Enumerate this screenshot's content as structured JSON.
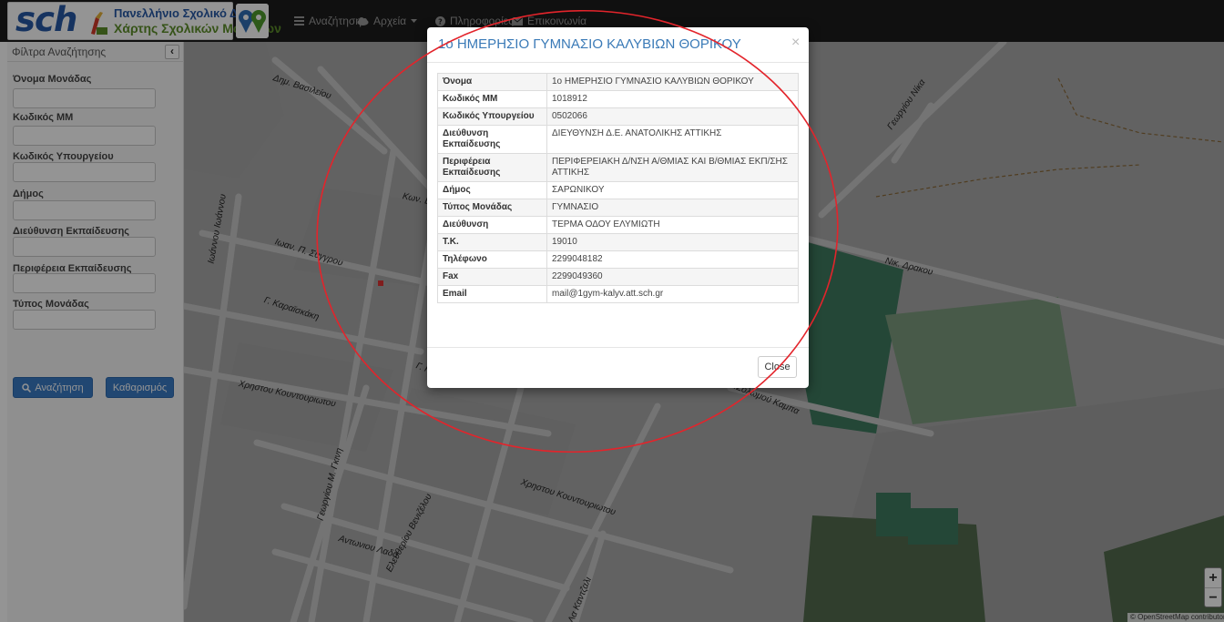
{
  "brand": {
    "logo_text": "sch",
    "line1": "Πανελλήνιο Σχολικό Δίκτυο",
    "line2": "Χάρτης Σχολικών Μονάδων"
  },
  "nav": {
    "search": "Αναζήτηση",
    "files": "Αρχεία",
    "info": "Πληροφορίες",
    "contact": "Επικοινωνία"
  },
  "sidebar": {
    "title": "Φίλτρα Αναζήτησης",
    "collapse_glyph": "‹",
    "filters": [
      {
        "label": "Όνομα Μονάδας",
        "value": ""
      },
      {
        "label": "Κωδικός ΜΜ",
        "value": ""
      },
      {
        "label": "Κωδικός Υπουργείου",
        "value": ""
      },
      {
        "label": "Δήμος",
        "value": ""
      },
      {
        "label": "Διεύθυνση Εκπαίδευσης",
        "value": ""
      },
      {
        "label": "Περιφέρεια Εκπαίδευσης",
        "value": ""
      },
      {
        "label": "Τύπος Μονάδας",
        "value": ""
      }
    ],
    "search_button": "Αναζήτηση",
    "clear_button": "Καθαρισμός"
  },
  "map": {
    "streets": [
      "Δημ. Βασιλείου",
      "Ιωάννου Ιωάννου",
      "Κων. Ελ...",
      "Ιωαν. Π. Συγγρου",
      "Γ. Καραϊσκάκη",
      "Χρηστου Κουντουριωτου",
      "Γεωργίου Μ. Γκινη",
      "Αντωνιου Λαδα",
      "Ελευθερίου Βενιζέλου",
      "Χρηστου Κουντουριωτου",
      "Γεωργίου Νίκα",
      "Νικ. Δρακου",
      "Δ.Σολωμού Καμπα",
      "Γ. Κ...",
      "Λα Καντζαλι"
    ],
    "zoom_in": "+",
    "zoom_out": "−",
    "attribution": "© OpenStreetMap contributors"
  },
  "modal": {
    "title": "1ο ΗΜΕΡΗΣΙΟ ΓΥΜΝΑΣΙΟ ΚΑΛΥΒΙΩΝ ΘΟΡΙΚΟΥ",
    "close_glyph": "×",
    "rows": [
      {
        "key": "Όνομα",
        "value": "1ο ΗΜΕΡΗΣΙΟ ΓΥΜΝΑΣΙΟ ΚΑΛΥΒΙΩΝ ΘΟΡΙΚΟΥ"
      },
      {
        "key": "Κωδικός ΜΜ",
        "value": "1018912"
      },
      {
        "key": "Κωδικός Υπουργείου",
        "value": "0502066"
      },
      {
        "key": "Διεύθυνση Εκπαίδευσης",
        "value": "ΔΙΕΥΘΥΝΣΗ Δ.Ε. ΑΝΑΤΟΛΙΚΗΣ ΑΤΤΙΚΗΣ"
      },
      {
        "key": "Περιφέρεια Εκπαίδευσης",
        "value": "ΠΕΡΙΦΕΡΕΙΑΚΗ Δ/ΝΣΗ Α/ΘΜΙΑΣ ΚΑΙ Β/ΘΜΙΑΣ ΕΚΠ/ΣΗΣ ΑΤΤΙΚΗΣ"
      },
      {
        "key": "Δήμος",
        "value": "ΣΑΡΩΝΙΚΟΥ"
      },
      {
        "key": "Τύπος Μονάδας",
        "value": "ΓΥΜΝΑΣΙΟ"
      },
      {
        "key": "Διεύθυνση",
        "value": "ΤΕΡΜΑ ΟΔΟΥ ΕΛΥΜΙΩΤΗ"
      },
      {
        "key": "Τ.Κ.",
        "value": "19010"
      },
      {
        "key": "Τηλέφωνο",
        "value": "2299048182"
      },
      {
        "key": "Fax",
        "value": "2299049360"
      },
      {
        "key": "Email",
        "value": "mail@1gym-kalyv.att.sch.gr"
      }
    ],
    "close_button": "Close"
  },
  "colors": {
    "accent": "#3a7ab7",
    "navbar": "#1d1d1d",
    "annotation": "#e3242b"
  }
}
